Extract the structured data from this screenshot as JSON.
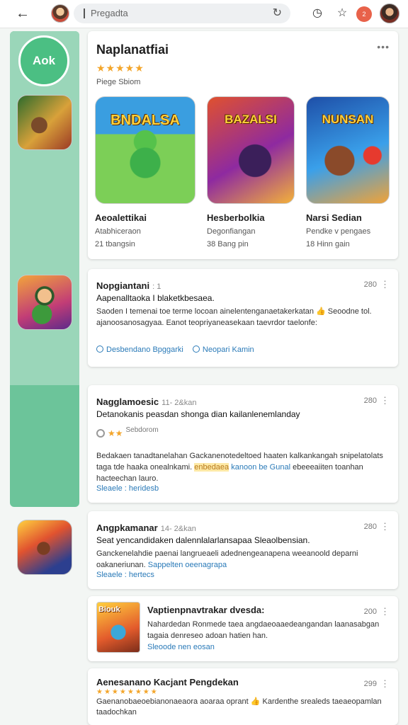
{
  "browser": {
    "back_icon": "back-arrow-icon",
    "url_text": "Pregadta",
    "reload_icon": "reload-icon",
    "ext_badge": "2"
  },
  "rail": {
    "badge_label": "Aok"
  },
  "featured": {
    "title": "Naplanatfiai",
    "stars": "★★★★★",
    "subtitle": "Piege Sbiom",
    "more": "•••",
    "tiles": [
      {
        "logo": "BNDALSA",
        "name": "Aeoalettikai",
        "dev": "Atabhiceraon",
        "meta": "21 tbangsin"
      },
      {
        "logo": "BAZALSI",
        "name": "Hesberbolkia",
        "dev": "Degonfiangan",
        "meta": "38 Bang pin"
      },
      {
        "logo": "NUNSAN",
        "name": "Narsi Sedian",
        "dev": "Pendke v pengaes",
        "meta": "18 Hinn gain"
      }
    ]
  },
  "reviews": [
    {
      "author": "Nopgiantani",
      "date": ": 1",
      "number": "280",
      "line1": "Aapenalltaoka I blaketkbesaea.",
      "body": "Saoden I temenai toe terme locoan ainelentenganaetakerkatan 👍 Seoodne tol. ajanoosanosagyaa. Eanot teopriyaneasekaan taevrdor taelonfe:",
      "actions": [
        "Desbendano Bpggarki",
        "Neopari Kamin"
      ]
    },
    {
      "author": "Nagglamoesic",
      "date": "11- 2&kan",
      "number": "280",
      "line1": "Detanokanis peasdan shonga dian kailanlenemlanday",
      "rating_stars": "★★",
      "rating_sub": "Sebdorom",
      "body": "Bedakaen tanadtanelahan Gackanenotedeltoed haaten kalkankangah snipelatolats taga tde haaka onealnkami.",
      "highlight": "enbedaea",
      "body2": "kanoon be Gunal",
      "body3": "ebeeeaiiten toanhan hacteechan lauro.",
      "actions": [
        "Sleaele : heridesb"
      ]
    },
    {
      "author": "Angpkamanar",
      "date": "14- 2&kan",
      "number": "280",
      "line1": "Seat yencandidaken dalennlalarlansapaa Sleaolbensian.",
      "body": "Ganckenelahdie paenai langrueaeli adednengeanapena weeanoold deparni oakaneriunan.",
      "link": "Sappelten oeenagrapa",
      "actions": [
        "Sleaele : hertecs"
      ]
    }
  ],
  "promo": {
    "thumb_text": "Biouk",
    "title": "Vaptienpnavtrakar dvesda:",
    "number": "200",
    "body": "Nahardedan Ronmede taea angdaeoaaedeangandan laanasabgan tagaia denreseo adoan hatien han.",
    "link": "Sleoode nen eosan"
  },
  "bottom": {
    "title": "Aenesanano Kacjant Pengdekan",
    "stars": "★★★★★★★★",
    "number": "299",
    "body": "Gaenanobaeoebianonaeaora aoaraa oprant 👍 Kardenthe srealeds taeaeopamlan taadochkan"
  }
}
